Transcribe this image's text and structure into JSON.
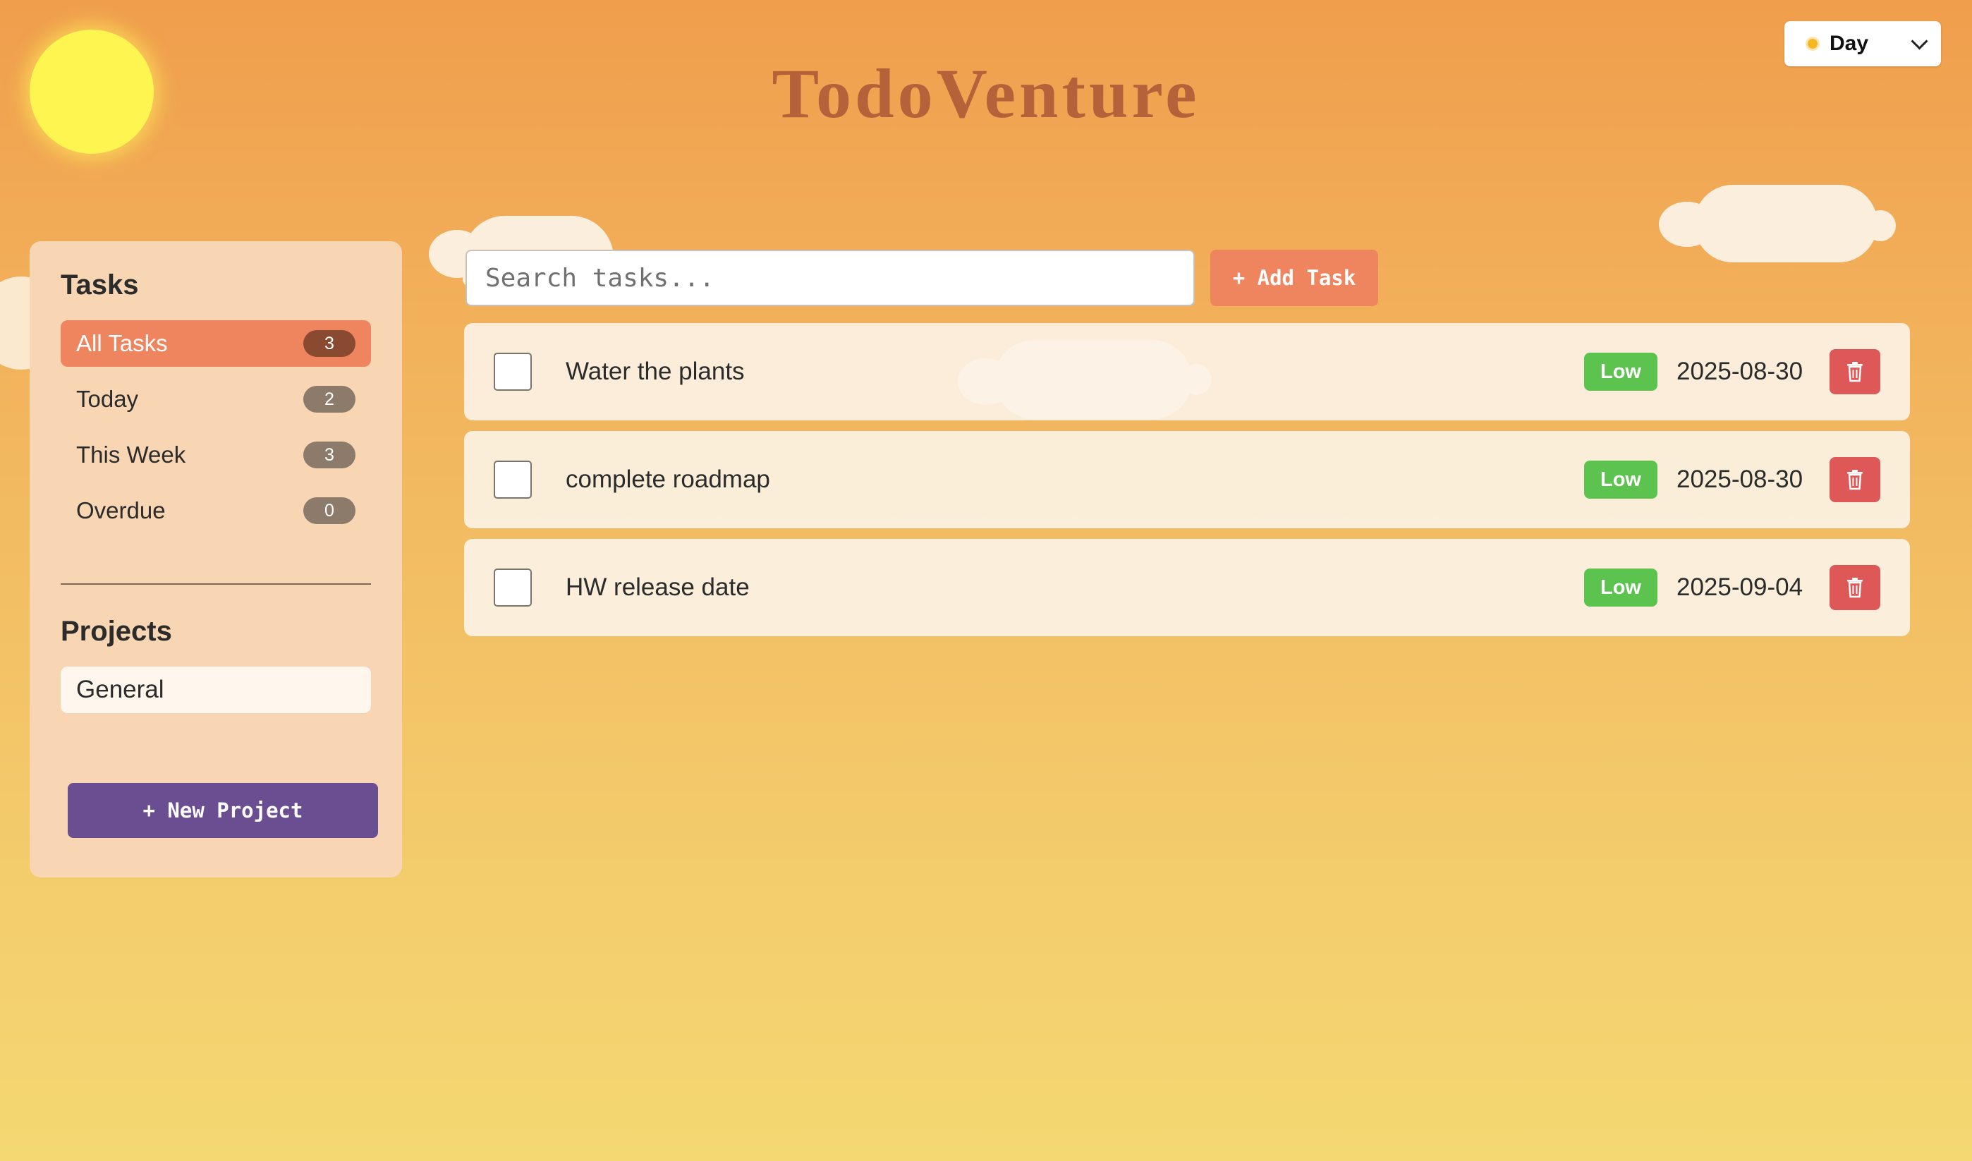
{
  "header": {
    "title": "TodoVenture",
    "theme_selector": {
      "selected": "Day",
      "icon": "sun-icon"
    }
  },
  "sidebar": {
    "tasks_heading": "Tasks",
    "filters": [
      {
        "label": "All Tasks",
        "count": "3",
        "active": true
      },
      {
        "label": "Today",
        "count": "2",
        "active": false
      },
      {
        "label": "This Week",
        "count": "3",
        "active": false
      },
      {
        "label": "Overdue",
        "count": "0",
        "active": false
      }
    ],
    "projects_heading": "Projects",
    "projects": [
      {
        "label": "General"
      }
    ],
    "new_project_label": "+ New Project"
  },
  "main": {
    "search": {
      "placeholder": "Search tasks...",
      "value": ""
    },
    "add_task_label": "+ Add Task",
    "tasks": [
      {
        "title": "Water the plants",
        "priority": "Low",
        "due": "2025-08-30",
        "done": false
      },
      {
        "title": "complete roadmap",
        "priority": "Low",
        "due": "2025-08-30",
        "done": false
      },
      {
        "title": "HW release date",
        "priority": "Low",
        "due": "2025-09-04",
        "done": false
      }
    ]
  },
  "colors": {
    "accent": "#EF855E",
    "title": "#B5623B",
    "priority_low": "#5CC44E",
    "delete": "#DF5858",
    "new_project": "#6A4E91"
  }
}
